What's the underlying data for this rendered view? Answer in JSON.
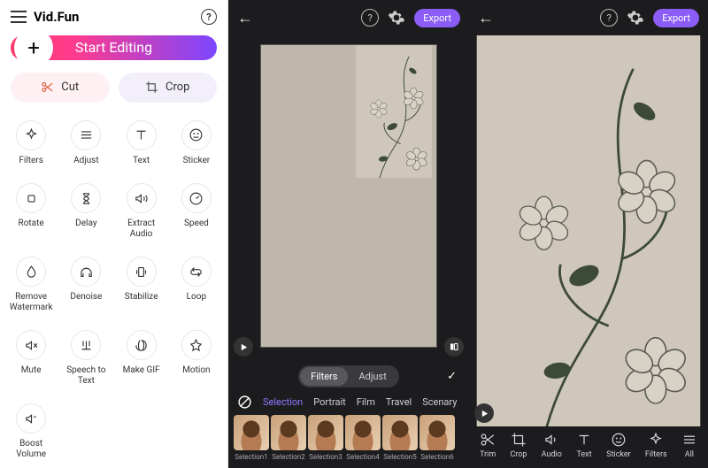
{
  "app": {
    "name": "Vid.Fun"
  },
  "start_button": {
    "label": "Start Editing"
  },
  "cutcrop": {
    "cut": "Cut",
    "crop": "Crop"
  },
  "tools": {
    "filters": "Filters",
    "adjust": "Adjust",
    "text": "Text",
    "sticker": "Sticker",
    "rotate": "Rotate",
    "delay": "Delay",
    "extract_audio": "Extract Audio",
    "speed": "Speed",
    "remove_watermark": "Remove Watermark",
    "denoise": "Denoise",
    "stabilize": "Stabilize",
    "loop": "Loop",
    "mute": "Mute",
    "speech_to_text": "Speech to Text",
    "make_gif": "Make GIF",
    "motion": "Motion",
    "boost_volume": "Boost Volume"
  },
  "editor": {
    "export": "Export",
    "tabs": {
      "filters": "Filters",
      "adjust": "Adjust"
    },
    "categories": [
      "Selection",
      "Portrait",
      "Film",
      "Travel",
      "Scenary"
    ],
    "thumbs": [
      "Selection1",
      "Selection2",
      "Selection3",
      "Selection4",
      "Selection5",
      "Selection6"
    ]
  },
  "bottom_tools": {
    "trim": "Trim",
    "crop": "Crop",
    "audio": "Audio",
    "text": "Text",
    "sticker": "Sticker",
    "filters": "Filters",
    "all": "All"
  }
}
